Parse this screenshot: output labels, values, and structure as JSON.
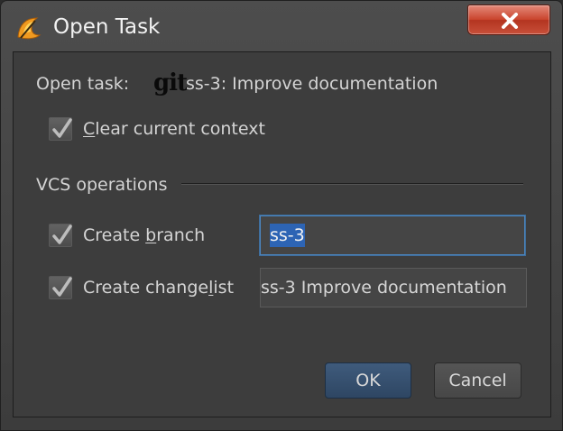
{
  "window": {
    "title": "Open Task",
    "close_glyph": "X",
    "app_icon": "intellij-idea-icon"
  },
  "open_task": {
    "label": "Open task:",
    "vcs_logo": "git",
    "task_name": "ss-3: Improve documentation"
  },
  "clear_context": {
    "label_before": "",
    "mnemonic": "C",
    "label_after": "lear current context",
    "checked": true
  },
  "vcs_operations": {
    "section_title": "VCS operations",
    "create_branch": {
      "label_before": "Create ",
      "mnemonic": "b",
      "label_after": "ranch",
      "checked": true,
      "value": "ss-3"
    },
    "create_changelist": {
      "label_before": "Create change",
      "mnemonic": "l",
      "label_after": "ist",
      "checked": true,
      "value": "ss-3 Improve documentation"
    }
  },
  "buttons": {
    "ok": "OK",
    "cancel": "Cancel"
  },
  "colors": {
    "background": "#3d3d3d",
    "text": "#d4d4d4",
    "focus_border": "#4b86c0",
    "selection": "#2d64b4",
    "close_button": "#c9432c"
  }
}
